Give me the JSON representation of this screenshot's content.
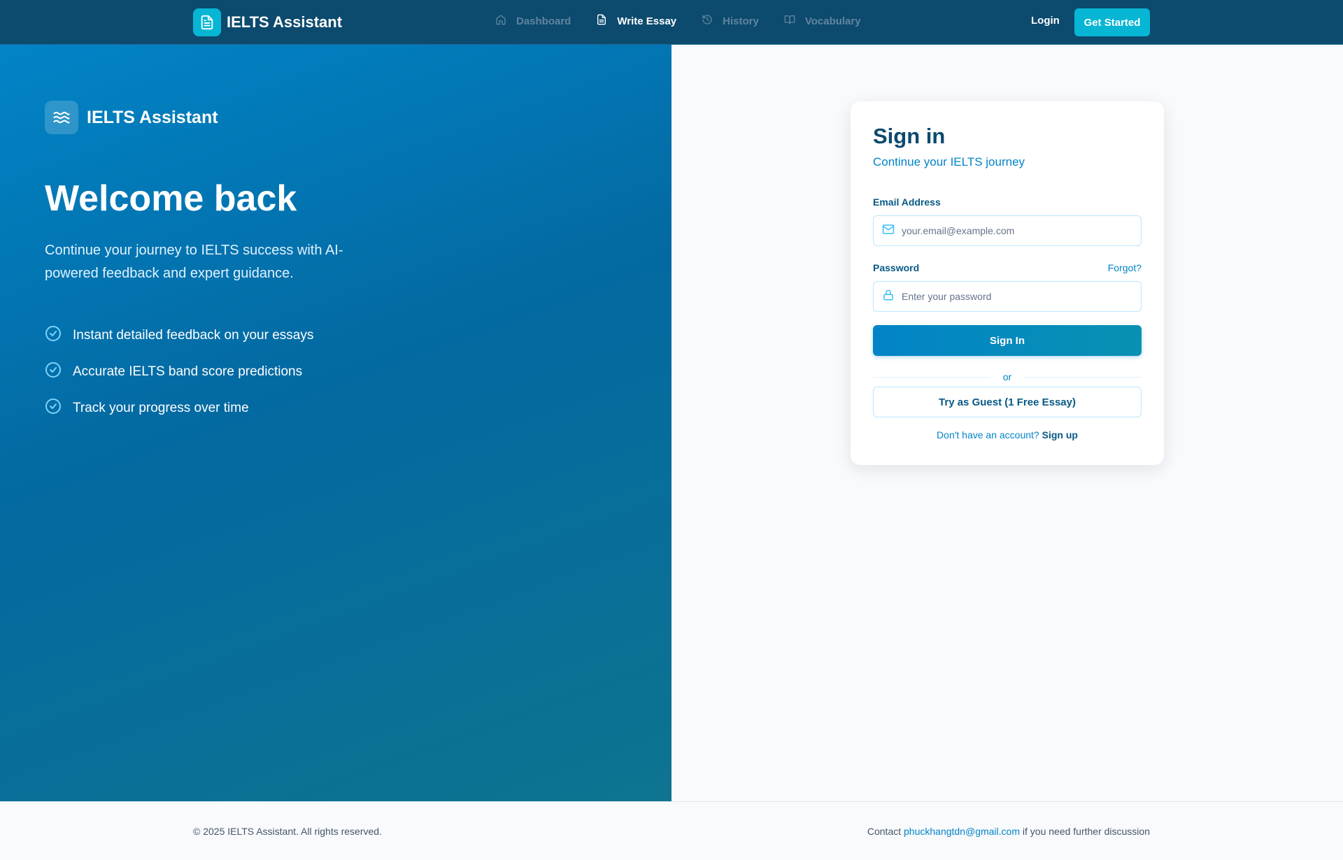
{
  "nav": {
    "brand": "IELTS Assistant",
    "brand_icon": "document-icon",
    "links": [
      {
        "label": "Dashboard",
        "icon": "home-icon",
        "active": false
      },
      {
        "label": "Write Essay",
        "icon": "document-icon",
        "active": true
      },
      {
        "label": "History",
        "icon": "history-icon",
        "active": false
      },
      {
        "label": "Vocabulary",
        "icon": "book-icon",
        "active": false
      }
    ],
    "login_label": "Login",
    "get_started_label": "Get Started"
  },
  "hero": {
    "brand": "IELTS Assistant",
    "brand_icon": "waves-icon",
    "title": "Welcome back",
    "subtitle": "Continue your journey to IELTS success with AI-powered feedback and expert guidance.",
    "features": [
      "Instant detailed feedback on your essays",
      "Accurate IELTS band score predictions",
      "Track your progress over time"
    ]
  },
  "signin": {
    "title": "Sign in",
    "subtitle": "Continue your IELTS journey",
    "email_label": "Email Address",
    "email_placeholder": "your.email@example.com",
    "password_label": "Password",
    "forgot_label": "Forgot?",
    "password_placeholder": "Enter your password",
    "submit_label": "Sign In",
    "divider_label": "or",
    "guest_label": "Try as Guest (1 Free Essay)",
    "signup_prompt": "Don't have an account?",
    "signup_label": "Sign up"
  },
  "footer": {
    "copyright": "© 2025 IELTS Assistant. All rights reserved.",
    "contact_prefix": "Contact",
    "contact_email": "phuckhangtdn@gmail.com",
    "contact_suffix": "if you need further discussion"
  },
  "colors": {
    "nav_bg": "#0c4a6e",
    "accent": "#06b6d4",
    "primary": "#0284c7",
    "hero_gradient_start": "#0284c7",
    "hero_gradient_end": "#0e7490"
  }
}
